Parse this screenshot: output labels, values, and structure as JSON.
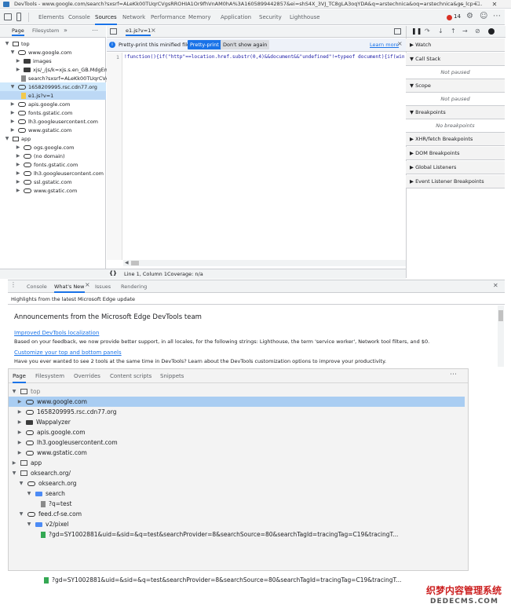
{
  "window": {
    "title": "DevTools - www.google.com/search?sxsrf=ALeKk00TUqrCVgsRROHIA1Or9fhVnAM0hA%3A1605899442857&ei=shS4X_3VJ_TC8gLA3oqYDA&q=arstechnica&oq=arstechnica&gs_lcp=...",
    "min": "─",
    "max": "☐",
    "close": "✕"
  },
  "maintabs": {
    "items": [
      "Elements",
      "Console",
      "Sources",
      "Network",
      "Performance",
      "Memory",
      "Application",
      "Security",
      "Lighthouse"
    ],
    "error_count": "14"
  },
  "navigator": {
    "tabs": [
      "Page",
      "Filesystem"
    ],
    "more": "»",
    "menu": "⋯",
    "tree": [
      "top",
      "www.google.com",
      "images",
      "xjs/_/js/k=xjs.s.en_GB.MdgEma",
      "search?sxsrf=ALeKk00TUqrCVg",
      "1658209995.rsc.cdn77.org",
      "e1.js?v=1",
      "apis.google.com",
      "fonts.gstatic.com",
      "lh3.googleusercontent.com",
      "www.gstatic.com",
      "app",
      "ogs.google.com",
      "(no domain)",
      "fonts.gstatic.com",
      "lh3.googleusercontent.com",
      "ssl.gstatic.com",
      "www.gstatic.com"
    ]
  },
  "editor": {
    "tab_label": "e1.js?v=1",
    "tab_close": "×",
    "prettyprint_message": "Pretty-print this minified file?",
    "prettyprint_button": "Pretty-print",
    "dont_show_button": "Don't show again",
    "learn_more": "Learn more",
    "info_close": "×",
    "line_number": "1",
    "code_line": "!function(){if(\"http\"==location.href.substr(0,4)&&document&&\"undefined\"!=typeof document){if(wind",
    "status_braces": "{}",
    "status_position": "Line 1, Column 1",
    "status_coverage": "Coverage: n/a"
  },
  "debugger": {
    "sections": [
      "Watch",
      "Call Stack",
      "Not paused",
      "Scope",
      "Not paused",
      "Breakpoints",
      "No breakpoints",
      "XHR/fetch Breakpoints",
      "DOM Breakpoints",
      "Global Listeners",
      "Event Listener Breakpoints"
    ]
  },
  "drawer": {
    "menu": "⋮",
    "tabs": [
      "Console",
      "What's New",
      "Issues",
      "Rendering"
    ],
    "tab_close": "×",
    "close": "✕",
    "highlights": "Highlights from the latest Microsoft Edge update",
    "heading": "Announcements from the Microsoft Edge DevTools team",
    "item1_title": "Improved DevTools localization",
    "item1_text": "Based on your feedback, we now provide better support, in all locales, for the following strings: Lighthouse, the term 'service worker', Network tool filters, and $0.",
    "item2_title": "Customize your top and bottom panels",
    "item2_text": "Have you ever wanted to see 2 tools at the same time in DevTools? Learn about the DevTools customization options to improve your productivity."
  },
  "lower_panel": {
    "tabs": [
      "Page",
      "Filesystem",
      "Overrides",
      "Content scripts",
      "Snippets"
    ],
    "menu": "⋯",
    "tree": [
      "top",
      "www.google.com",
      "1658209995.rsc.cdn77.org",
      "Wappalyzer",
      "apis.google.com",
      "lh3.googleusercontent.com",
      "www.gstatic.com",
      "app",
      "oksearch.org/",
      "oksearch.org",
      "search",
      "?q=test",
      "feed.cf-se.com",
      "v2/pixel",
      "?gd=SY1002881&uid=&sid=&q=test&searchProvider=8&searchSource=80&searchTagId=tracingTag=C19&tracingT..."
    ]
  },
  "background": {
    "bottom_file": "?gd=SY1002881&uid=&sid=&q=test&searchProvider=8&searchSource=80&searchTagId=tracingTag=C19&tracingT...",
    "watermark_cn": "织梦内容管理系统",
    "watermark_en": "DEDECMS.COM"
  }
}
